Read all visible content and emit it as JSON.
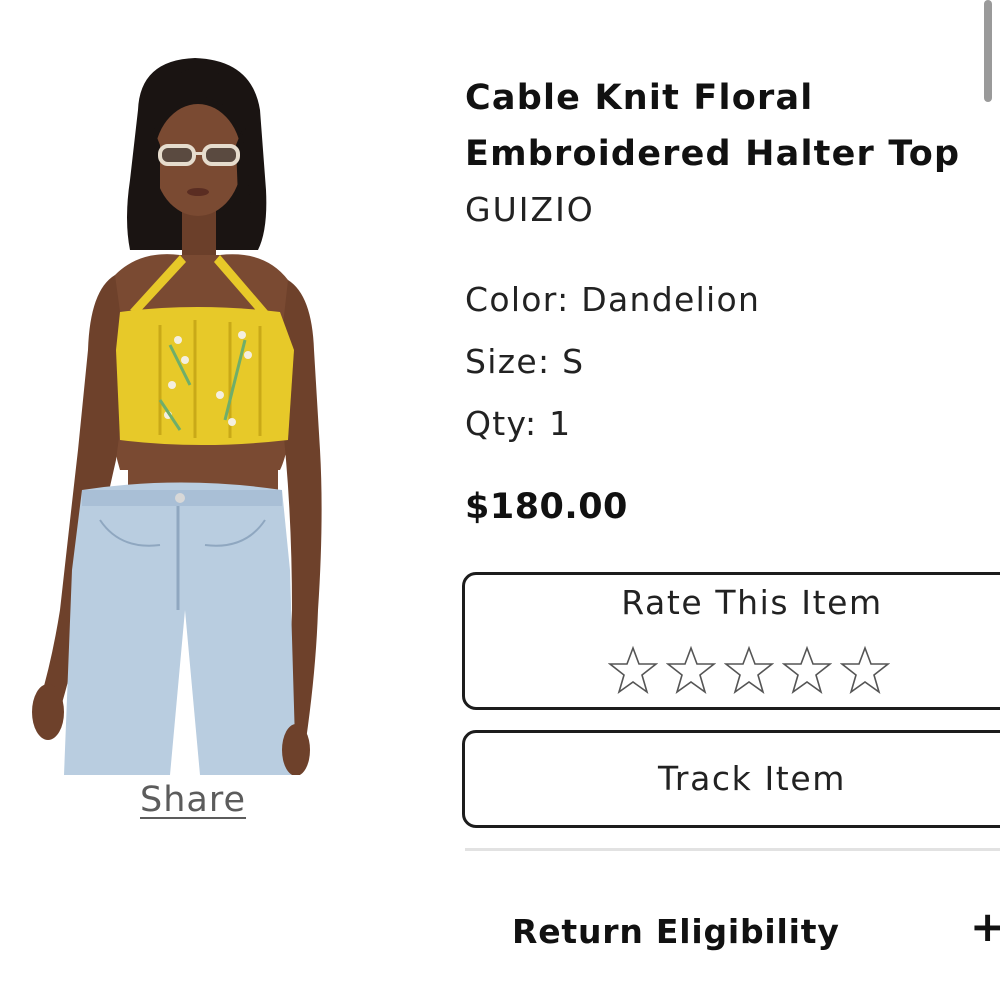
{
  "product": {
    "title": "Cable Knit Floral Embroidered Halter Top",
    "brand": "GUIZIO",
    "color_text": "Color: Dandelion",
    "size_text": "Size: S",
    "qty_text": "Qty: 1",
    "price": "$180.00",
    "image_icon": "product-photo"
  },
  "share": {
    "label": "Share"
  },
  "rating": {
    "title": "Rate This Item",
    "stars_total": 5,
    "stars_filled": 0
  },
  "track": {
    "label": "Track Item"
  },
  "return_section": {
    "label": "Return Eligibility",
    "toggle_symbol": "+"
  },
  "colors": {
    "top_yellow": "#e7c929",
    "denim": "#b9cde0",
    "text_dark": "#111111",
    "link_gray": "#5c5c5c"
  }
}
